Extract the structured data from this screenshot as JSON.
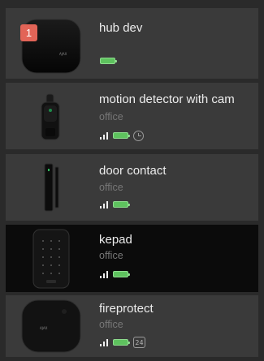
{
  "devices": [
    {
      "name": "hub dev",
      "room": "",
      "notification_count": "1",
      "icon": "hub-icon",
      "status": {
        "signal": false,
        "battery": true,
        "extra": ""
      }
    },
    {
      "name": "motion detector with cam",
      "room": "office",
      "icon": "motion-detector-cam-icon",
      "status": {
        "signal": true,
        "battery": true,
        "extra": "clock-icon"
      }
    },
    {
      "name": "door contact",
      "room": "office",
      "icon": "door-contact-icon",
      "status": {
        "signal": true,
        "battery": true,
        "extra": ""
      }
    },
    {
      "name": "kepad",
      "room": "office",
      "selected": true,
      "icon": "keypad-icon",
      "status": {
        "signal": true,
        "battery": true,
        "extra": ""
      }
    },
    {
      "name": "fireprotect",
      "room": "office",
      "icon": "fire-detector-icon",
      "status": {
        "signal": true,
        "battery": true,
        "extra": "24-hour-badge",
        "extra_text": "24"
      }
    }
  ],
  "colors": {
    "background": "#2a2a2a",
    "row": "#3a3a3a",
    "row_selected": "#0b0b0b",
    "battery": "#5ec25e",
    "notification": "#e26457",
    "room_text": "#777777"
  }
}
